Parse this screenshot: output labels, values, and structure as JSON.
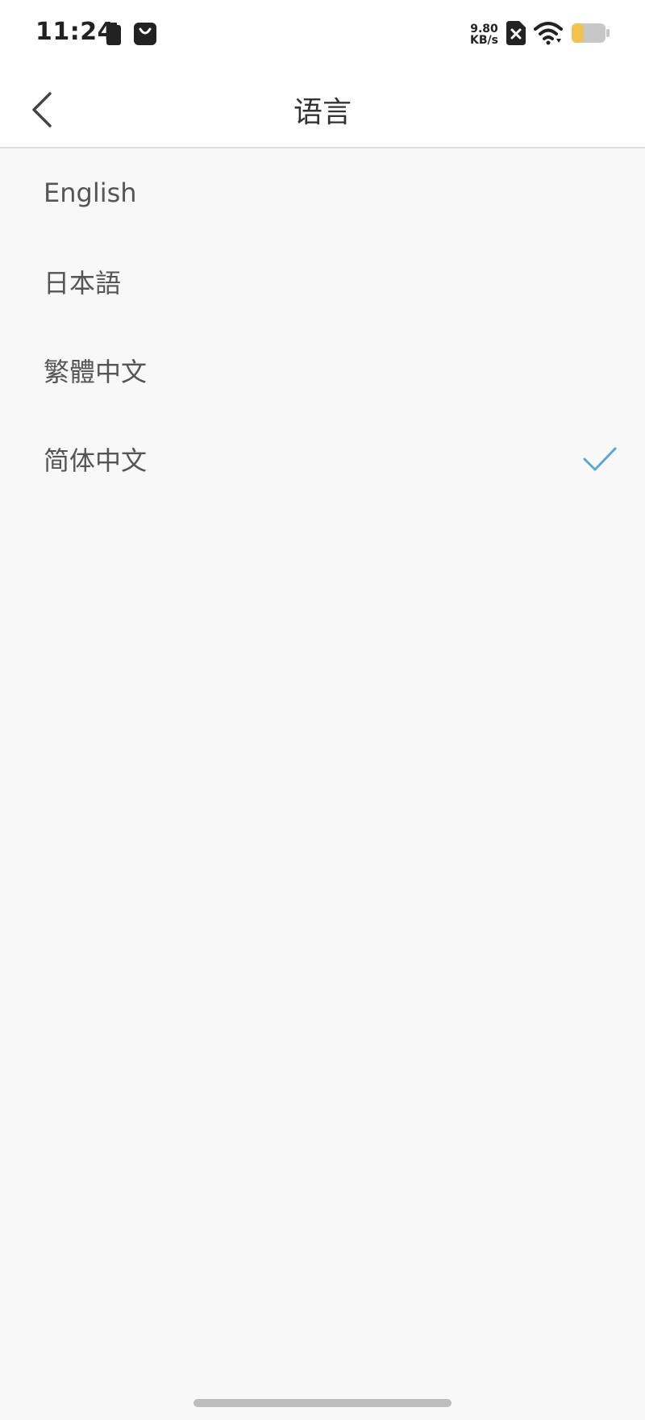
{
  "status_bar": {
    "time": "11:24",
    "net_speed_value": "9.80",
    "net_speed_unit": "KB/s",
    "battery_level": 0.35,
    "battery_accent": "#f2c14e"
  },
  "header": {
    "title": "语言"
  },
  "languages": [
    {
      "label": "English",
      "selected": false
    },
    {
      "label": "日本語",
      "selected": false
    },
    {
      "label": "繁體中文",
      "selected": false
    },
    {
      "label": "简体中文",
      "selected": true
    }
  ],
  "colors": {
    "check": "#5aa6d6",
    "background": "#f8f8f8"
  }
}
